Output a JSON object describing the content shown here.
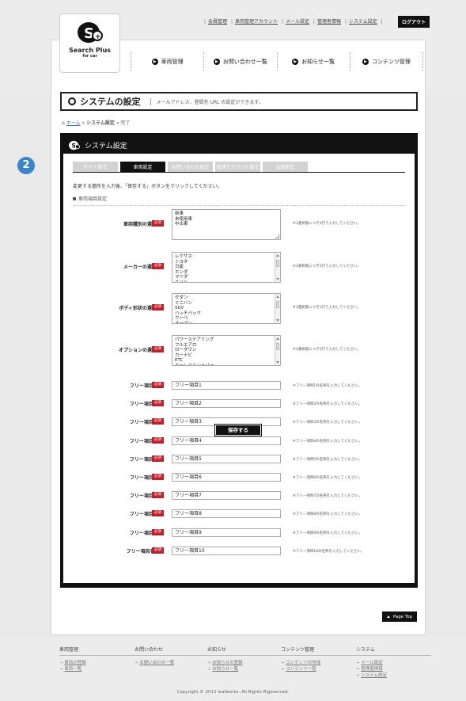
{
  "header": {
    "logo_title": "Search Plus",
    "logo_sub": "for car",
    "top_links": [
      "会員管理",
      "車両管理アカウント",
      "メール設定",
      "管理者情報",
      "システム設定"
    ],
    "logout": "ログアウト",
    "nav": [
      "車両管理",
      "お問い合わせ一覧",
      "お知らせ一覧",
      "コンテンツ管理"
    ]
  },
  "page": {
    "title": "システムの設定",
    "subtitle": "メールアドレス、登録先 URL の設定ができます。",
    "breadcrumb": {
      "home": "ホーム",
      "sep": "»",
      "current": "システム設定",
      "last": "完了"
    },
    "step": "2"
  },
  "panel": {
    "title": "システム設定",
    "tabs": [
      "サイト設定",
      "車両設定",
      "お問い合わせ設定",
      "管理アカウント設定",
      "会員設定"
    ],
    "active_tab": 1,
    "instruction": "変更する箇所を入力後、「保存する」ボタンをクリックしてください。",
    "section": "車両項目設定",
    "required": "必須",
    "fields": [
      {
        "label": "車両種別の選択肢",
        "lines": [
          "新車",
          "未使用車",
          "中古車"
        ],
        "note": "※1選択肢につき1行で入力してください。"
      },
      {
        "label": "メーカーの選択肢",
        "lines": [
          "レクサス",
          "トヨタ",
          "日産",
          "ホンダ",
          "マツダ",
          "スバル"
        ],
        "note": "※1選択肢につき1行で入力してください。"
      },
      {
        "label": "ボディ形状の選択肢",
        "lines": [
          "セダン",
          "ミニバン",
          "SUV",
          "ハッチバック",
          "クーペ",
          "オープン"
        ],
        "note": "※1選択肢につき1行で入力してください。"
      },
      {
        "label": "オプションの選択肢",
        "lines": [
          "パワーステアリング",
          "フルエアロ",
          "ローダウン",
          "カーナビ",
          "ETC",
          "キーレスエントリー"
        ],
        "note": "※1選択肢につき1行で入力してください。"
      }
    ],
    "free_items": [
      {
        "label": "フリー項目名1",
        "value": "フリー項目1",
        "note": "※フリー項目1の名称を入力してください。"
      },
      {
        "label": "フリー項目名2",
        "value": "フリー項目2",
        "note": "※フリー項目2の名称を入力してください。"
      },
      {
        "label": "フリー項目名3",
        "value": "フリー項目3",
        "note": "※フリー項目3の名称を入力してください。"
      },
      {
        "label": "フリー項目名4",
        "value": "フリー項目4",
        "note": "※フリー項目4の名称を入力してください。"
      },
      {
        "label": "フリー項目名5",
        "value": "フリー項目5",
        "note": "※フリー項目5の名称を入力してください。"
      },
      {
        "label": "フリー項目名6",
        "value": "フリー項目6",
        "note": "※フリー項目6の名称を入力してください。"
      },
      {
        "label": "フリー項目名7",
        "value": "フリー項目7",
        "note": "※フリー項目7の名称を入力してください。"
      },
      {
        "label": "フリー項目名8",
        "value": "フリー項目8",
        "note": "※フリー項目8の名称を入力してください。"
      },
      {
        "label": "フリー項目名9",
        "value": "フリー項目9",
        "note": "※フリー項目9の名称を入力してください。"
      },
      {
        "label": "フリー項目名10",
        "value": "フリー項目10",
        "note": "※フリー項目10の名称を入力してください。"
      }
    ],
    "save": "保存する"
  },
  "page_top": "Page Top",
  "footer": {
    "columns": [
      {
        "head": "車両管理",
        "links": [
          "車両の登録",
          "車両一覧"
        ]
      },
      {
        "head": "お問い合わせ",
        "links": [
          "お問い合わせ一覧"
        ]
      },
      {
        "head": "お知らせ",
        "links": [
          "お知らせの登録",
          "お知らせ一覧"
        ]
      },
      {
        "head": "コンテンツ管理",
        "links": [
          "コンテンツの作成",
          "コンテンツ一覧"
        ]
      },
      {
        "head": "システム",
        "links": [
          "メール設定",
          "管理者情報",
          "システム設定"
        ]
      }
    ],
    "copyright": "Copyright © 2012 leafworks. All Rights Rigeserved."
  },
  "colors": {
    "required": "#c0202a",
    "step_badge": "#3c83c8",
    "dark": "#111111"
  }
}
